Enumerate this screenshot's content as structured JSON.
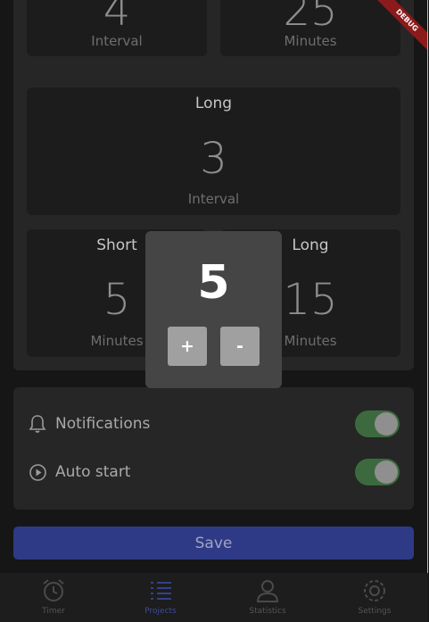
{
  "cards": {
    "top_left": {
      "num": "4",
      "unit": "Interval"
    },
    "top_right": {
      "num": "25",
      "unit": "Minutes"
    },
    "long_interval": {
      "label": "Long",
      "num": "3",
      "unit": "Interval"
    },
    "short": {
      "label": "Short",
      "num": "5",
      "unit": "Minutes"
    },
    "long_minutes": {
      "label": "Long",
      "num": "15",
      "unit": "Minutes"
    }
  },
  "overlay": {
    "value": "5",
    "plus": "+",
    "minus": "-"
  },
  "settings": {
    "notifications": {
      "label": "Notifications",
      "icon": "bell-icon",
      "on": true
    },
    "auto_start": {
      "label": "Auto start",
      "icon": "play-circle-icon",
      "on": true
    }
  },
  "save_label": "Save",
  "nav": [
    {
      "label": "Timer",
      "icon": "alarm-clock-icon",
      "active": false
    },
    {
      "label": "Projects",
      "icon": "list-icon",
      "active": true
    },
    {
      "label": "Statistics",
      "icon": "person-icon",
      "active": false
    },
    {
      "label": "Settings",
      "icon": "gear-icon",
      "active": false
    }
  ],
  "debug_banner": "DEBUG",
  "colors": {
    "accent": "#2f3a86",
    "toggle_on": "#3c6a3e",
    "debug": "#8b1a1a"
  }
}
